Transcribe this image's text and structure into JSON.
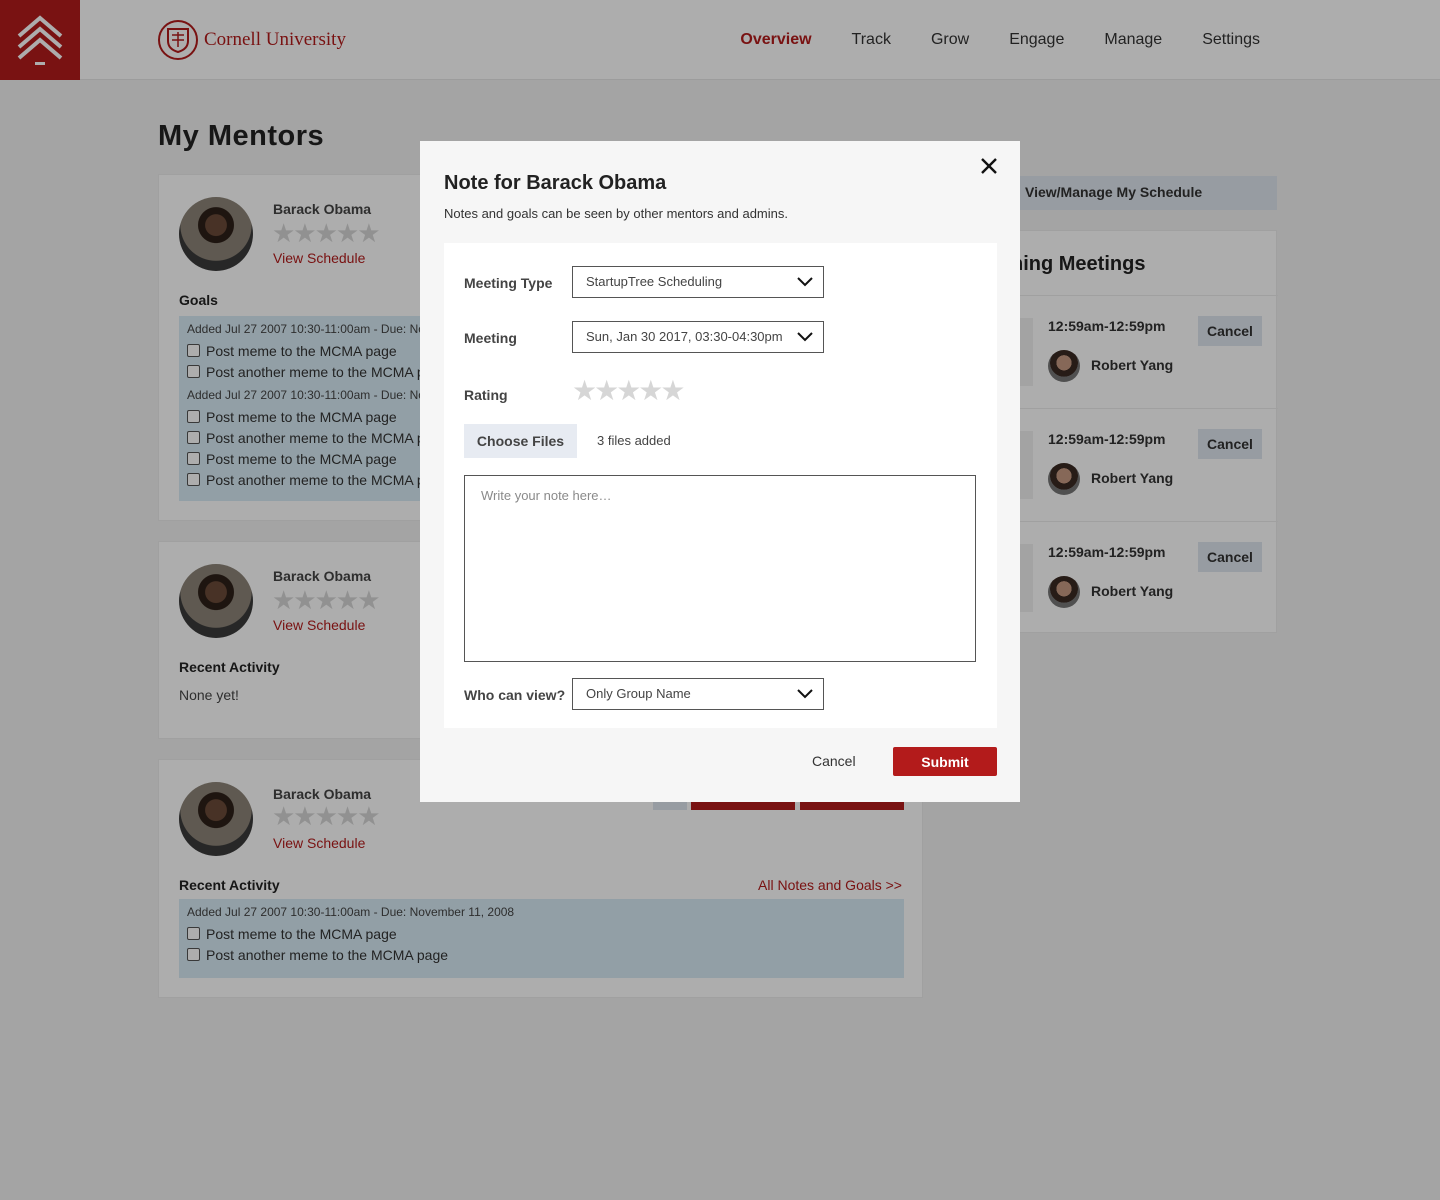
{
  "header": {
    "logo_icon": "chevrons-up-icon",
    "brand": "Cornell University",
    "nav": [
      {
        "label": "Overview",
        "active": true
      },
      {
        "label": "Track",
        "active": false
      },
      {
        "label": "Grow",
        "active": false
      },
      {
        "label": "Engage",
        "active": false
      },
      {
        "label": "Manage",
        "active": false
      },
      {
        "label": "Settings",
        "active": false
      }
    ]
  },
  "page": {
    "title": "My Mentors"
  },
  "mentors": [
    {
      "name": "Barack Obama",
      "rating_stars": "★★★★★",
      "view_schedule": "View Schedule",
      "section": "Goals",
      "goal_groups": [
        {
          "meta": "Added Jul 27 2007 10:30-11:00am - Due: No",
          "items": [
            "Post meme to the MCMA page",
            "Post another meme to the MCMA p"
          ]
        },
        {
          "meta": "Added Jul 27 2007 10:30-11:00am - Due: No",
          "items": [
            "Post meme to the MCMA page",
            "Post another meme to the MCMA p",
            "Post meme to the MCMA page",
            "Post another meme to the MCMA p"
          ]
        }
      ]
    },
    {
      "name": "Barack Obama",
      "rating_stars": "★★★★★",
      "view_schedule": "View Schedule",
      "section": "Recent Activity",
      "empty_text": "None yet!"
    },
    {
      "name": "Barack Obama",
      "rating_stars": "★★★★★",
      "view_schedule": "View Schedule",
      "section": "Recent Activity",
      "all_notes_link": "All Notes and Goals >>",
      "goal_groups": [
        {
          "meta": "Added Jul 27 2007 10:30-11:00am - Due: November 11, 2008",
          "items": [
            "Post meme to the MCMA page",
            "Post another meme to the MCMA page"
          ]
        }
      ]
    }
  ],
  "sidebar": {
    "schedule_button": "View/Manage My Schedule",
    "meetings_title": "ning Meetings",
    "meetings": [
      {
        "time": "12:59am-12:59pm",
        "person": "Robert Yang",
        "cancel": "Cancel"
      },
      {
        "time": "12:59am-12:59pm",
        "person": "Robert Yang",
        "cancel": "Cancel"
      },
      {
        "time": "12:59am-12:59pm",
        "person": "Robert Yang",
        "cancel": "Cancel"
      }
    ]
  },
  "modal": {
    "title": "Note for Barack Obama",
    "subtitle": "Notes and goals can be seen by other mentors and admins.",
    "close_icon": "close-icon",
    "meeting_type_label": "Meeting Type",
    "meeting_type_value": "StartupTree Scheduling",
    "meeting_label": "Meeting",
    "meeting_value": "Sun, Jan 30 2017, 03:30-04:30pm",
    "rating_label": "Rating",
    "rating_stars": "★★★★★",
    "rating_value": 0,
    "choose_files": "Choose Files",
    "files_added": "3 files added",
    "note_placeholder": "Write your note here…",
    "visibility_label": "Who can view?",
    "visibility_value": "Only Group Name",
    "cancel": "Cancel",
    "submit": "Submit"
  },
  "colors": {
    "brand_red": "#b31b1b",
    "goal_box": "#d7ebf5",
    "secondary_button": "#dfe6ef"
  }
}
